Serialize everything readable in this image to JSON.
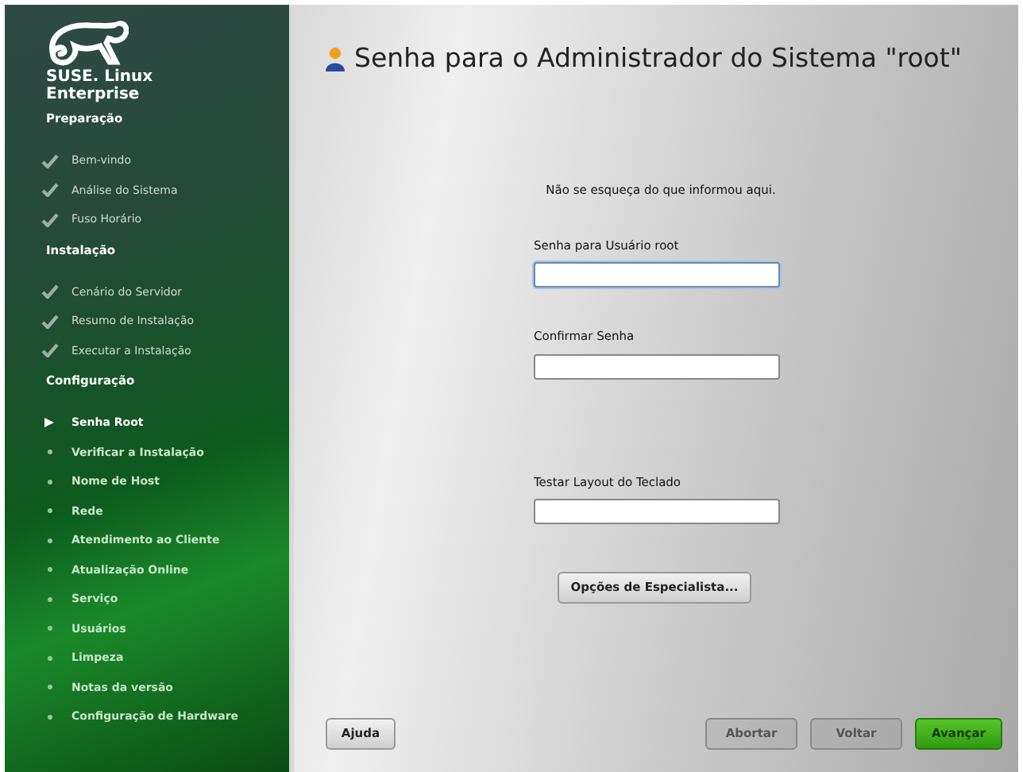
{
  "sidebar": {
    "brand": "SUSE. Linux Enterprise",
    "sections": [
      {
        "title": "Preparação",
        "items": [
          {
            "label": "Bem-vindo",
            "kind": "done"
          },
          {
            "label": "Análise do Sistema",
            "kind": "done"
          },
          {
            "label": "Fuso Horário",
            "kind": "done"
          }
        ]
      },
      {
        "title": "Instalação",
        "items": [
          {
            "label": "Cenário do Servidor",
            "kind": "done"
          },
          {
            "label": "Resumo de Instalação",
            "kind": "done"
          },
          {
            "label": "Executar a Instalação",
            "kind": "done"
          }
        ]
      },
      {
        "title": "Configuração",
        "items": [
          {
            "label": "Senha Root",
            "kind": "current"
          },
          {
            "label": "Verificar a Instalação",
            "kind": "pending"
          },
          {
            "label": "Nome de Host",
            "kind": "pending"
          },
          {
            "label": "Rede",
            "kind": "pending"
          },
          {
            "label": "Atendimento ao Cliente",
            "kind": "pending"
          },
          {
            "label": "Atualização Online",
            "kind": "pending"
          },
          {
            "label": "Serviço",
            "kind": "pending"
          },
          {
            "label": "Usuários",
            "kind": "pending"
          },
          {
            "label": "Limpeza",
            "kind": "pending"
          },
          {
            "label": "Notas da versão",
            "kind": "pending"
          },
          {
            "label": "Configuração de Hardware",
            "kind": "pending"
          }
        ]
      }
    ]
  },
  "title": "Senha para o Administrador do Sistema \"root\"",
  "hint": "Não se esqueça do que informou aqui.",
  "fields": [
    {
      "label": "Senha para Usuário root",
      "focused": true
    },
    {
      "label": "Confirmar Senha",
      "focused": false
    },
    {
      "label": "Testar Layout do Teclado",
      "focused": false
    }
  ],
  "expert_button": "Opções de Especialista...",
  "help_button": "Ajuda",
  "nav_buttons": [
    {
      "label": "Abortar",
      "kind": "plain"
    },
    {
      "label": "Voltar",
      "kind": "plain"
    },
    {
      "label": "Avançar",
      "kind": "primary"
    }
  ]
}
